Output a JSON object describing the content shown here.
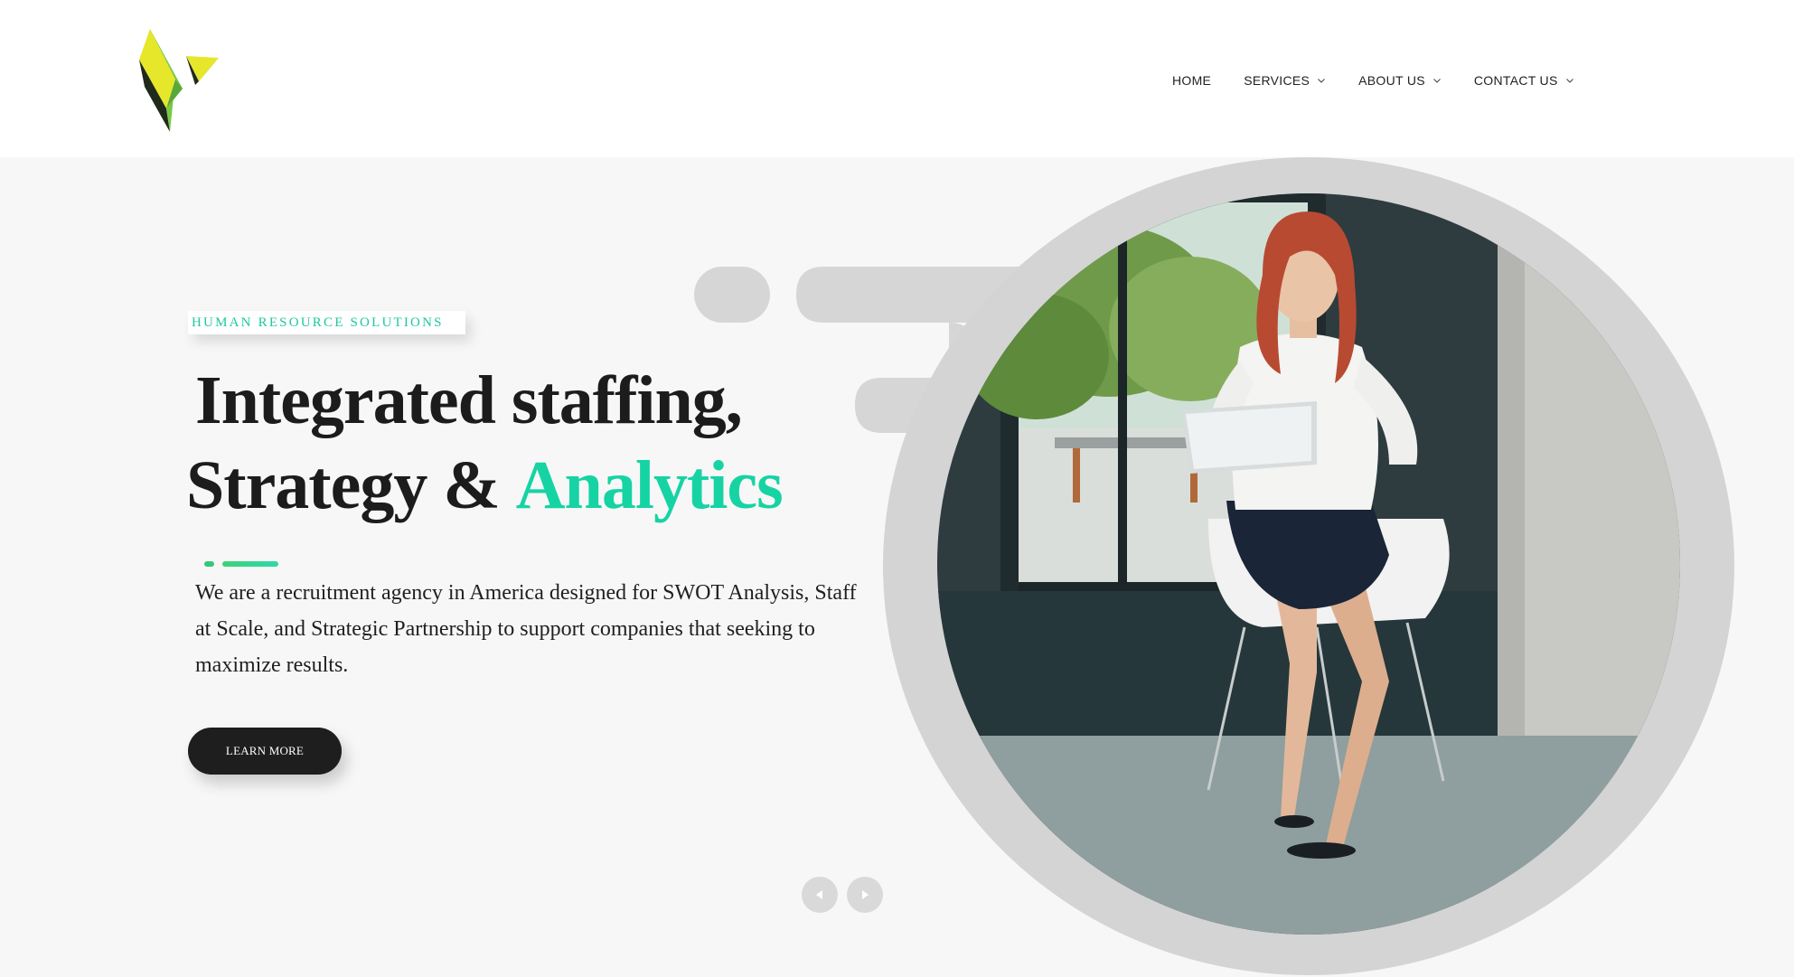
{
  "header": {
    "logo_name": "brand-logo",
    "nav": [
      {
        "label": "HOME",
        "has_dropdown": false
      },
      {
        "label": "SERVICES",
        "has_dropdown": true
      },
      {
        "label": "ABOUT US",
        "has_dropdown": true
      },
      {
        "label": "CONTACT US",
        "has_dropdown": true
      }
    ]
  },
  "hero": {
    "tagline": "HUMAN RESOURCE SOLUTIONS",
    "headline_line1": "Integrated staffing,",
    "headline_line2": "Strategy &",
    "headline_accent": "Analytics",
    "description": "We are a recruitment agency in America designed for SWOT Analysis, Staff at Scale, and Strategic Partnership to support companies that seeking to maximize results.",
    "cta_label": "LEARN MORE",
    "prev_icon": "triangle-left-icon",
    "next_icon": "triangle-right-icon"
  },
  "colors": {
    "accent": "#16d3a4",
    "dark": "#1e1e1e",
    "background": "#f7f7f7",
    "ring": "#d4d4d4"
  }
}
